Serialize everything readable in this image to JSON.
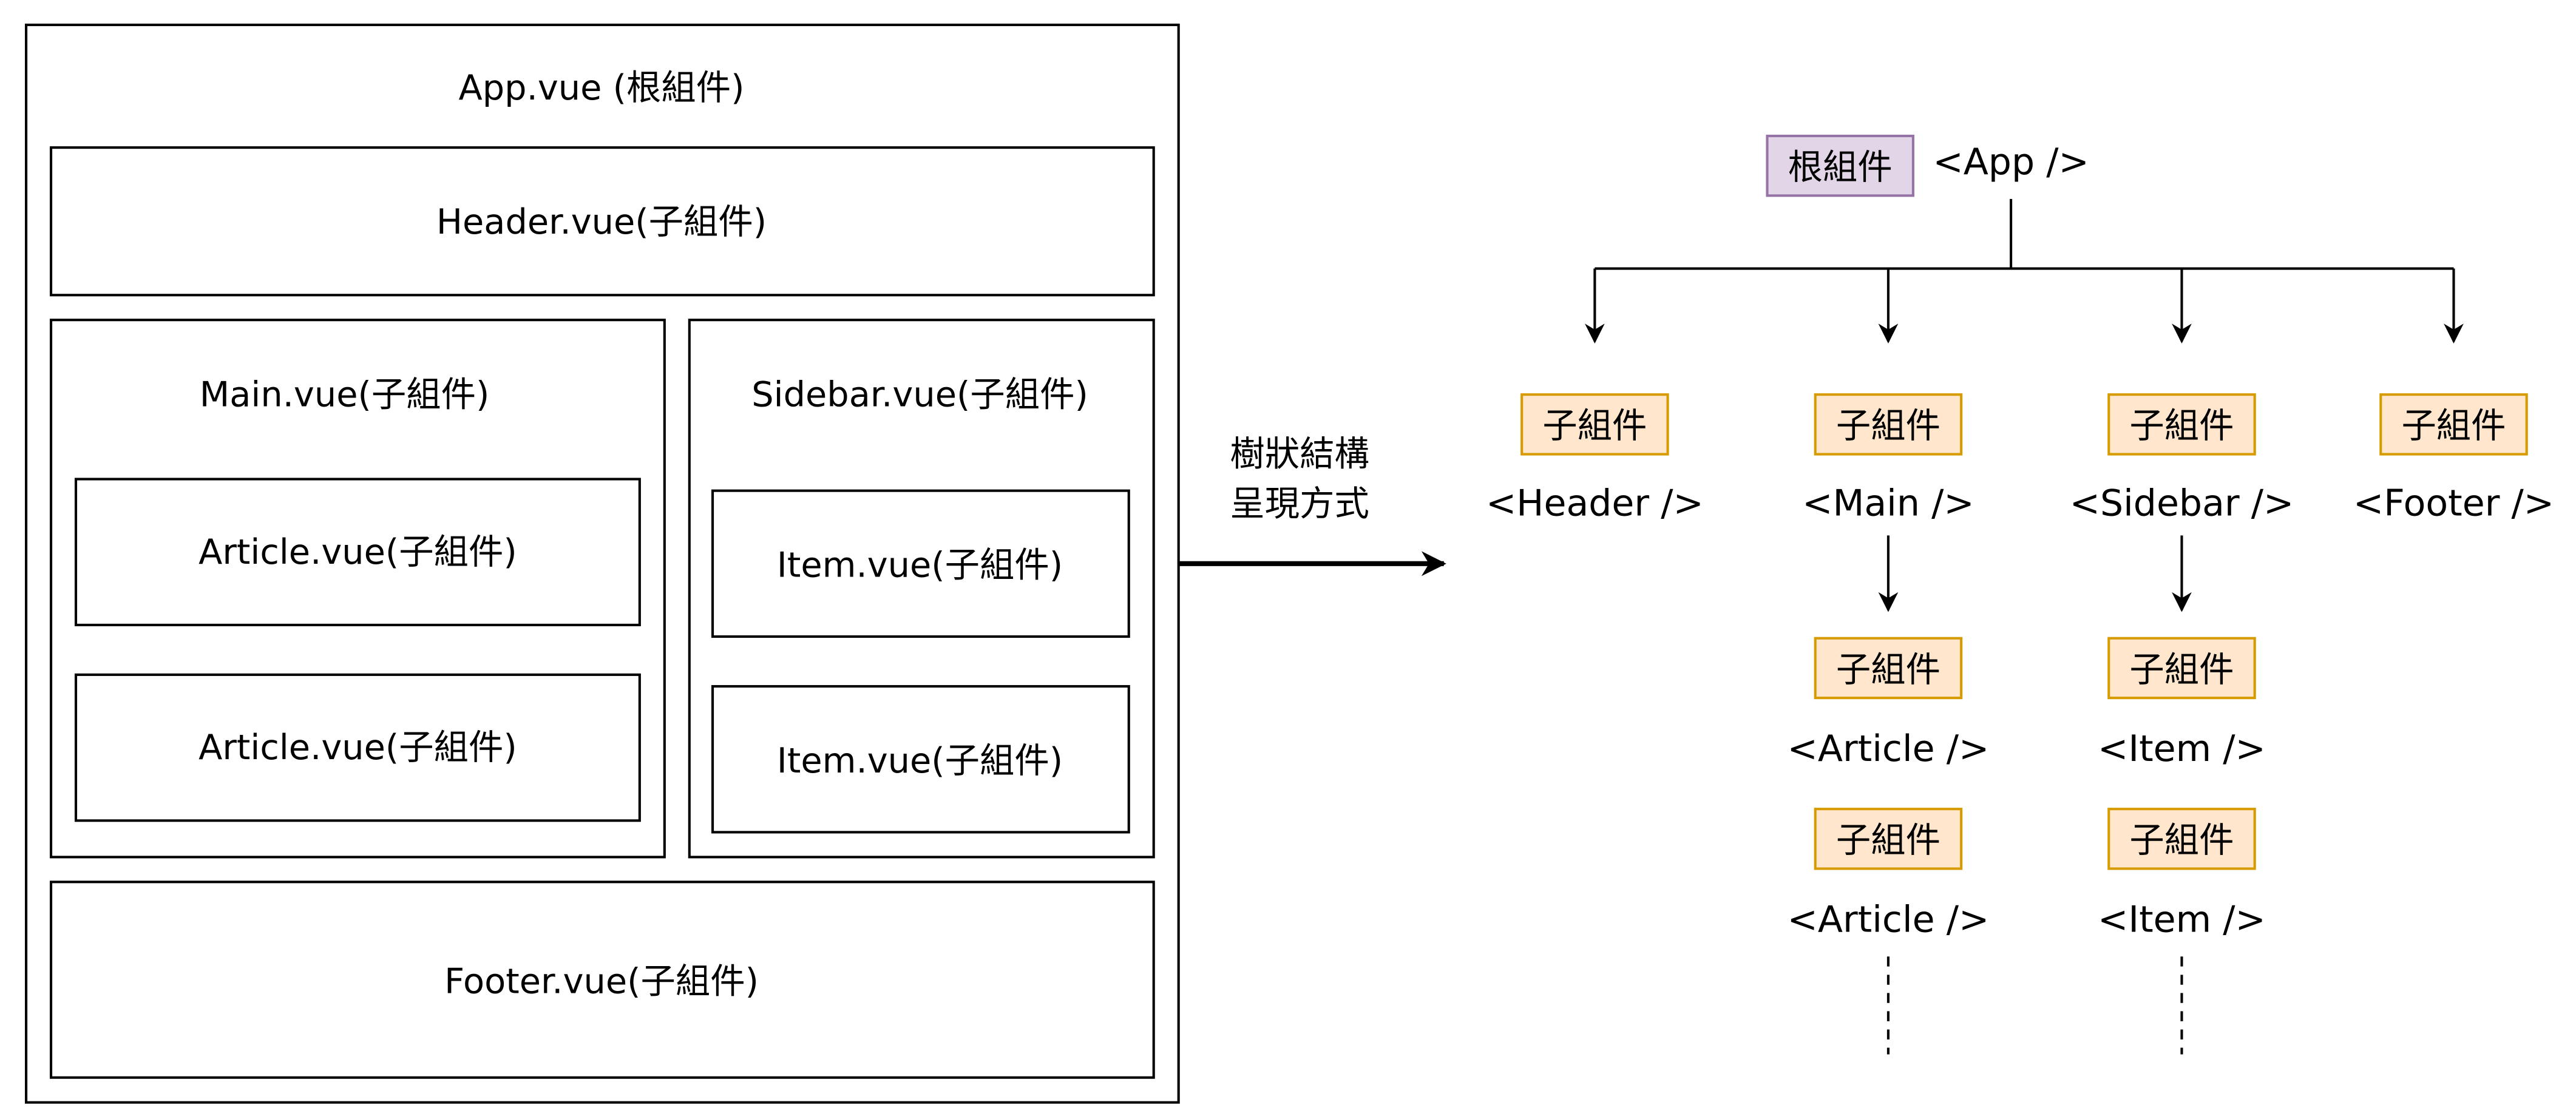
{
  "left_diagram": {
    "app": "App.vue (根組件)",
    "header": "Header.vue(子組件)",
    "main": "Main.vue(子組件)",
    "article_1": "Article.vue(子組件)",
    "article_2": "Article.vue(子組件)",
    "sidebar": "Sidebar.vue(子組件)",
    "item_1": "Item.vue(子組件)",
    "item_2": "Item.vue(子組件)",
    "footer": "Footer.vue(子組件)"
  },
  "transition": {
    "line1": "樹狀結構",
    "line2": "呈現方式"
  },
  "tree": {
    "root_tag": "根組件",
    "root_name": "<App />",
    "child_tag": "子組件",
    "children": {
      "header": "<Header />",
      "main": "<Main />",
      "sidebar": "<Sidebar />",
      "footer": "<Footer />",
      "article_1": "<Article />",
      "article_2": "<Article />",
      "item_1": "<Item />",
      "item_2": "<Item />"
    }
  },
  "colors": {
    "root_fill": "#e1d5e7",
    "root_stroke": "#9673a6",
    "child_fill": "#ffe6cc",
    "child_stroke": "#d79b00"
  }
}
